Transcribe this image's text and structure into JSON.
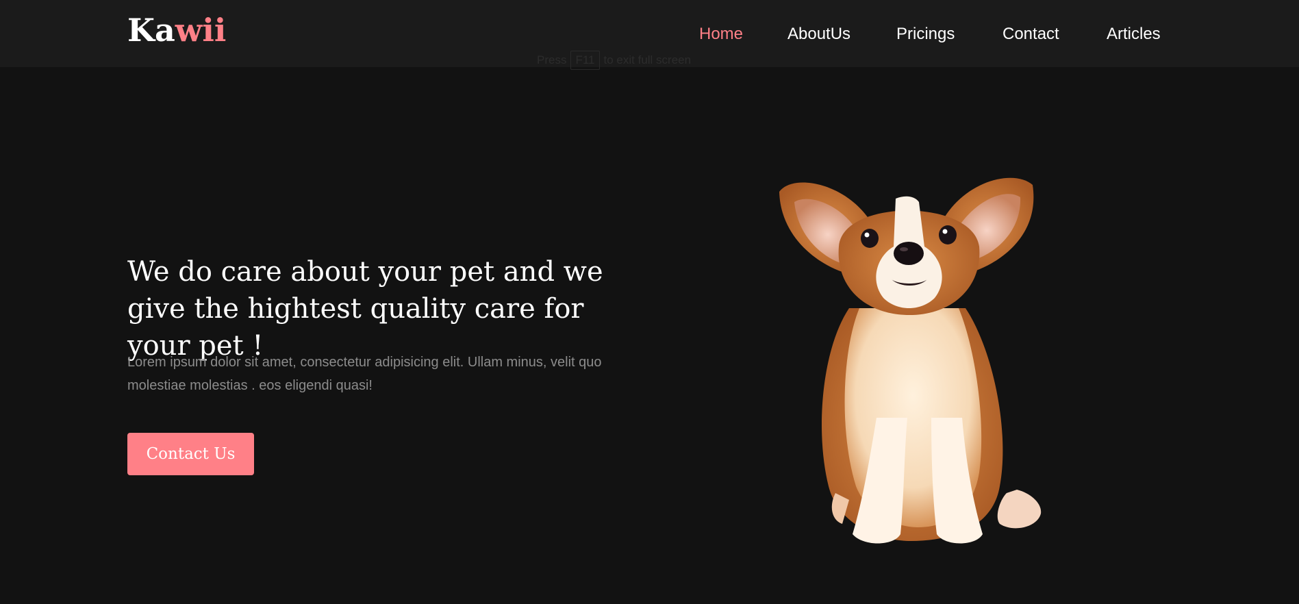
{
  "brand": {
    "logo_part1": "Ka",
    "logo_part2": "wii"
  },
  "nav": {
    "items": [
      {
        "label": "Home",
        "active": true
      },
      {
        "label": "AboutUs",
        "active": false
      },
      {
        "label": "Pricings",
        "active": false
      },
      {
        "label": "Contact",
        "active": false
      },
      {
        "label": "Articles",
        "active": false
      }
    ]
  },
  "fullscreen_hint": {
    "prefix": "Press",
    "key": "F11",
    "suffix": "to exit full screen"
  },
  "hero": {
    "headline": "We do care about your pet and we give the hightest quality care for your pet !",
    "body": "Lorem ipsum dolor sit amet, consectetur adipisicing elit. Ullam minus, velit quo molestiae molestias . eos eligendi quasi!",
    "cta_label": "Contact Us",
    "image_icon": "corgi-puppy-image"
  },
  "colors": {
    "accent": "#ff8087",
    "background": "#121212",
    "navbar": "#1b1b1b",
    "muted_text": "#8c8c8c"
  }
}
